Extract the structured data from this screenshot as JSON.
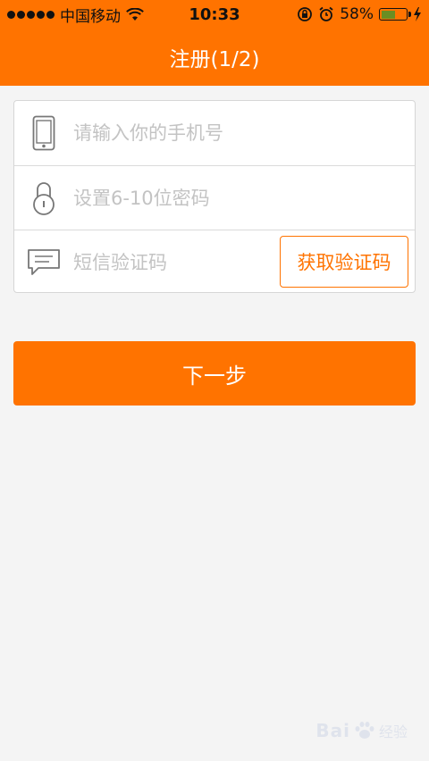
{
  "status_bar": {
    "carrier": "中国移动",
    "time": "10:33",
    "battery_percent": "58%",
    "battery_level": 0.58,
    "signal_bars": 5
  },
  "nav": {
    "title": "注册(1/2)"
  },
  "form": {
    "phone_placeholder": "请输入你的手机号",
    "password_placeholder": "设置6-10位密码",
    "sms_placeholder": "短信验证码",
    "get_code_label": "获取验证码"
  },
  "next_label": "下一步",
  "watermark": {
    "brand": "Bai",
    "suffix": "经验"
  },
  "colors": {
    "accent": "#ff7300",
    "background": "#f4f4f4"
  }
}
